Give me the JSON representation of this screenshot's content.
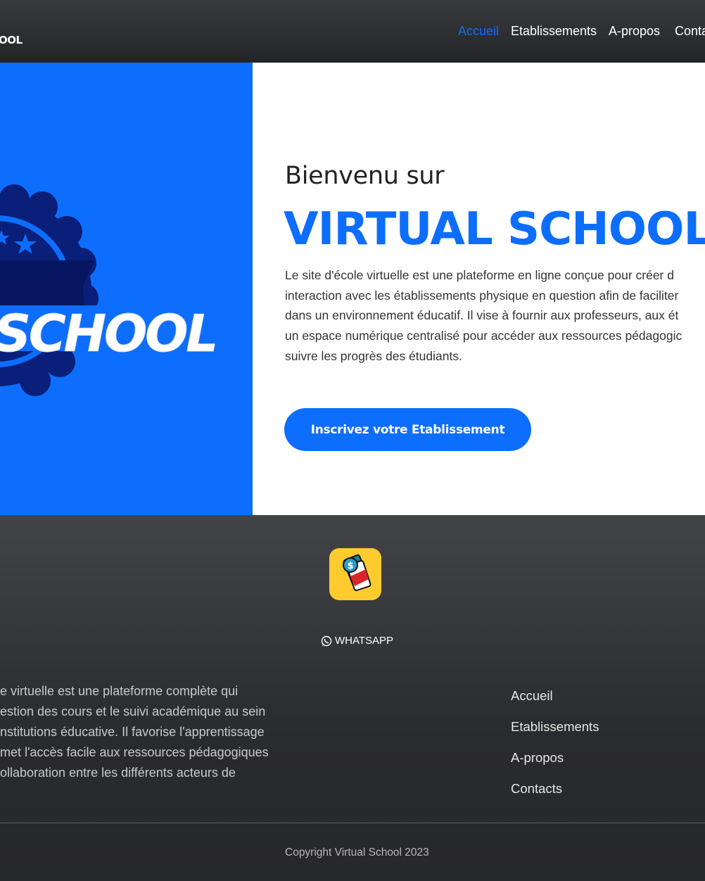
{
  "navbar": {
    "brand": "OOL",
    "links": [
      "Accueil",
      "Etablissements",
      "A-propos",
      "Conta"
    ],
    "active_index": 0
  },
  "hero": {
    "logo_text": "SCHOOL",
    "subtitle": "Bienvenu sur",
    "title": "VIRTUAL SCHOOL",
    "description_lines": [
      "Le site d'école virtuelle est une plateforme en ligne conçue pour créer d",
      "interaction avec les établissements physique en question afin de faciliter",
      "dans un environnement éducatif. Il vise à fournir aux professeurs, aux ét",
      "un espace numérique centralisé pour accéder aux ressources pédagogic",
      "suivre les progrès des étudiants."
    ],
    "cta_label": "Inscrivez votre Etablissement"
  },
  "footer": {
    "app_icon": "mobile-money-app-icon",
    "whatsapp_label": "WHATSAPP",
    "description_lines": [
      "e virtuelle est une plateforme complète qui",
      "estion des cours et le suivi académique au sein",
      "nstitutions éducative. Il favorise l'apprentissage",
      "met l'accès facile aux ressources pédagogiques",
      "ollaboration entre les différents acteurs de"
    ],
    "links": [
      "Accueil",
      "Etablissements",
      "A-propos",
      "Contacts"
    ],
    "copyright": "Copyright Virtual School 2023"
  },
  "colors": {
    "accent": "#0d6efd",
    "navbar_bg": "#2c2d30",
    "footer_bg": "#2b2c2f",
    "app_icon_bg": "#fecb2f"
  }
}
